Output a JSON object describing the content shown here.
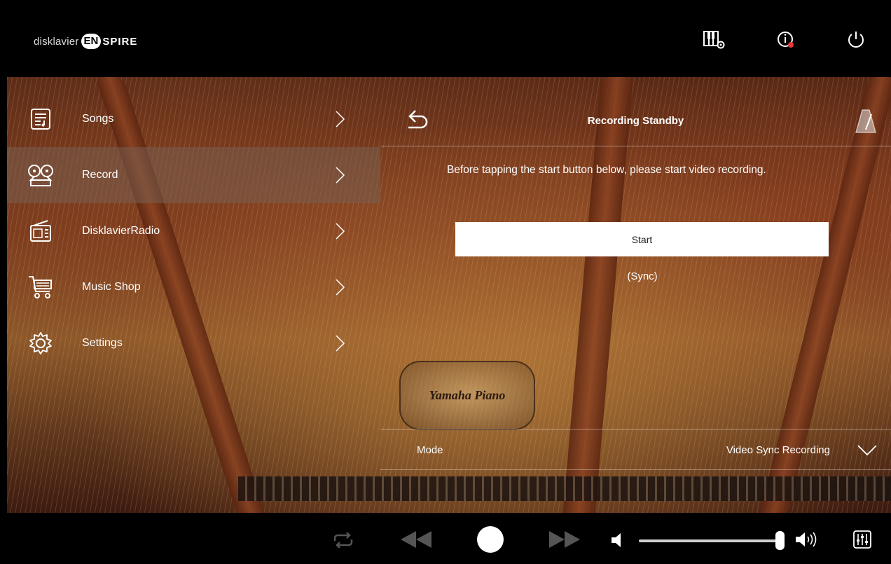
{
  "app": {
    "brand_prefix": "disklavier",
    "brand_badge": "EN",
    "brand_suffix": "SPIRE"
  },
  "top_icons": [
    "piano-settings-icon",
    "info-icon",
    "power-icon"
  ],
  "background": {
    "plate_text": "Yamaha Piano"
  },
  "sidebar": {
    "items": [
      {
        "label": "Songs",
        "icon": "songs-list-icon"
      },
      {
        "label": "Record",
        "icon": "tape-recorder-icon",
        "active": true
      },
      {
        "label": "DisklavierRadio",
        "icon": "radio-icon"
      },
      {
        "label": "Music Shop",
        "icon": "shopping-cart-icon"
      },
      {
        "label": "Settings",
        "icon": "gear-icon"
      }
    ]
  },
  "panel": {
    "title": "Recording Standby",
    "instruction": "Before tapping the start button below, please start video recording.",
    "start_button": "Start",
    "sync_label": "(Sync)",
    "mode_label": "Mode",
    "mode_value": "Video Sync Recording"
  },
  "transport": {
    "icons": [
      "repeat-icon",
      "rewind-icon",
      "record-icon",
      "fast-forward-icon",
      "volume-low-icon",
      "volume-high-icon",
      "mixer-icon"
    ],
    "volume_level": 0.97
  },
  "colors": {
    "accent_red": "#e23a3a",
    "bar_background": "#000000",
    "active_item": "#78625a"
  }
}
